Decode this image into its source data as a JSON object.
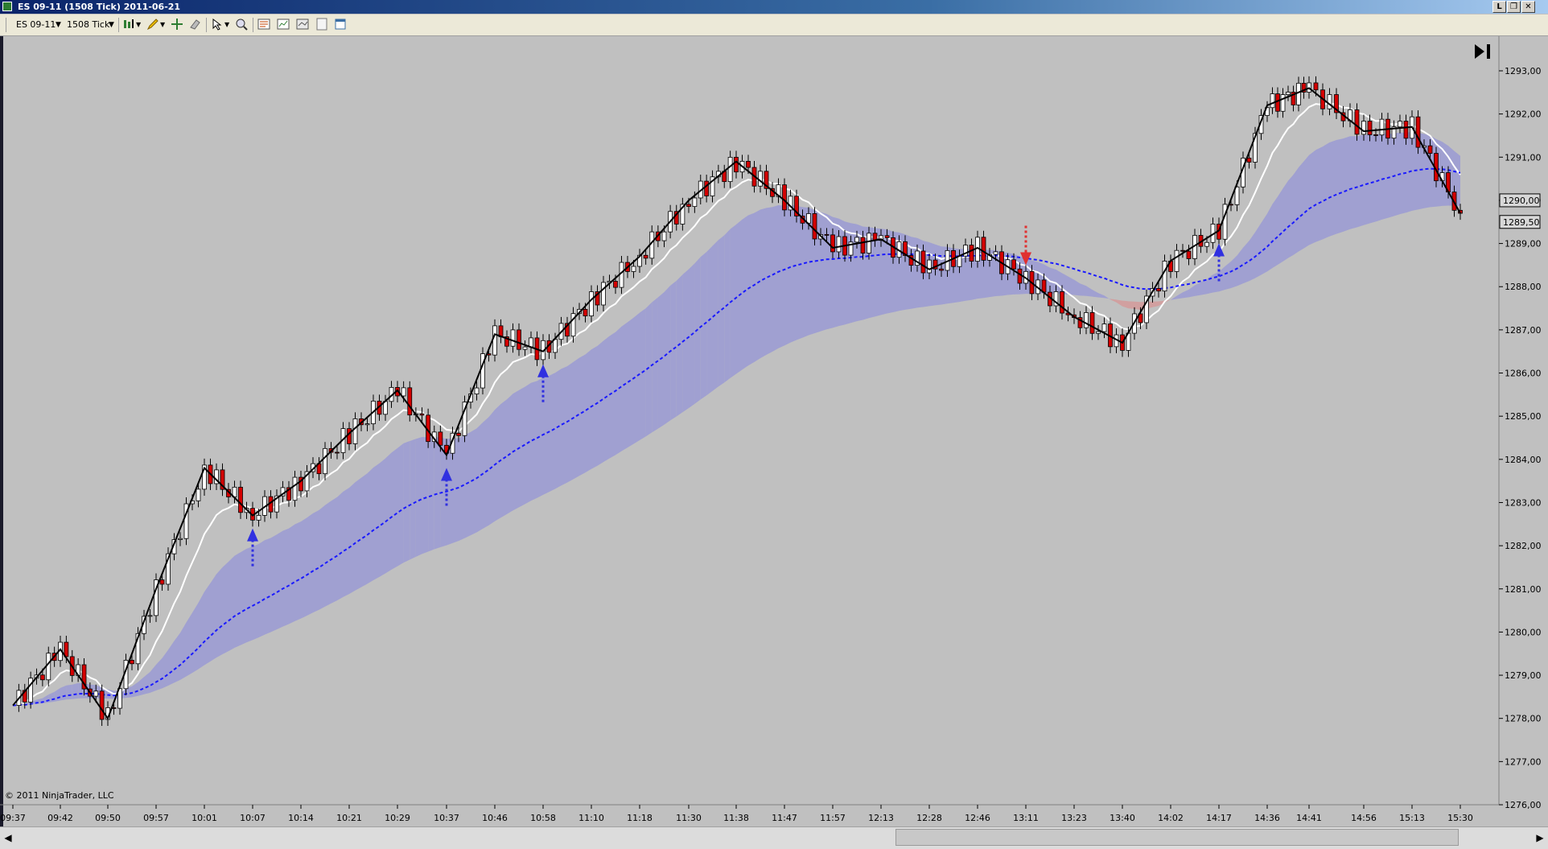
{
  "window": {
    "title": "ES 09-11 (1508 Tick)  2011-06-21",
    "buttons": [
      "L",
      "❐",
      "✕"
    ]
  },
  "toolbar": {
    "instrument": "ES 09-11",
    "period": "1508 Tick"
  },
  "chart": {
    "copyright": "© 2011 NinjaTrader, LLC",
    "y_ticks": [
      "1293,00",
      "1292,00",
      "1291,00",
      "1290,00",
      "1289,00",
      "1288,00",
      "1287,00",
      "1286,00",
      "1285,00",
      "1284,00",
      "1283,00",
      "1282,00",
      "1281,00",
      "1280,00",
      "1279,00",
      "1278,00",
      "1277,00",
      "1276,00"
    ],
    "x_ticks": [
      "09:37",
      "09:42",
      "09:50",
      "09:57",
      "10:01",
      "10:07",
      "10:14",
      "10:21",
      "10:29",
      "10:37",
      "10:46",
      "10:58",
      "11:10",
      "11:18",
      "11:30",
      "11:38",
      "11:47",
      "11:57",
      "12:13",
      "12:28",
      "12:46",
      "13:11",
      "13:23",
      "13:40",
      "14:02",
      "14:17",
      "14:36",
      "14:41",
      "14:56",
      "15:13",
      "15:30"
    ],
    "price_tags": [
      "1290,00",
      "1289,50"
    ],
    "colors": {
      "background": "#c0c0c0",
      "up_candle": "#ffffff",
      "down_candle": "#d40000",
      "cloud_bull": "#9a9ad4",
      "cloud_bear": "#d49a9a",
      "zigzag": "#000000",
      "ema_fast": "#ffffff",
      "ema_slow": "#1a1aff",
      "signal_up": "#3030e0",
      "signal_down": "#e03030"
    },
    "icons": [
      "bar-chart-icon",
      "pencil-icon",
      "crosshair-icon",
      "pointer-icon",
      "zoom-icon",
      "properties-icon",
      "indicators-icon",
      "strategies-icon",
      "data-box-icon",
      "window-icon",
      "end-of-chart-icon"
    ]
  },
  "chart_data": {
    "type": "line",
    "title": "",
    "xlabel": "",
    "ylabel": "",
    "ylim": [
      1275.8,
      1293.4
    ],
    "x": [
      "09:37",
      "09:42",
      "09:50",
      "09:57",
      "10:01",
      "10:07",
      "10:14",
      "10:21",
      "10:29",
      "10:37",
      "10:46",
      "10:58",
      "11:10",
      "11:18",
      "11:30",
      "11:38",
      "11:47",
      "11:57",
      "12:13",
      "12:28",
      "12:46",
      "13:11",
      "13:23",
      "13:40",
      "14:02",
      "14:17",
      "14:36",
      "14:41",
      "14:56",
      "15:13",
      "15:30"
    ],
    "series": [
      {
        "values": [
          1278.3,
          1279.6,
          1278.0,
          1281.0,
          1283.8,
          1282.7,
          1283.5,
          1284.6,
          1285.6,
          1284.1,
          1286.9,
          1286.5,
          1287.7,
          1288.7,
          1290.0,
          1290.9,
          1290.0,
          1288.9,
          1289.1,
          1288.4,
          1288.9,
          1288.2,
          1287.3,
          1286.7,
          1288.6,
          1289.3,
          1292.2,
          1292.6,
          1291.6,
          1291.7,
          1289.7
        ]
      }
    ]
  }
}
